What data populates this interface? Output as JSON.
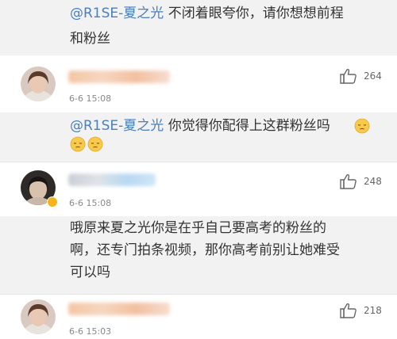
{
  "colors": {
    "mention": "#4a7fbf",
    "timestamp": "#888888",
    "background": "#f2f2f2"
  },
  "top_reply": {
    "mention": "@R1SE-夏之光",
    "text_line1": " 不闭着眼夸你，请你想想前程",
    "text_line2": "和粉丝"
  },
  "comments": [
    {
      "time": "6-6 15:08",
      "likes": "264",
      "reply_mention": "@R1SE-夏之光",
      "reply_text": " 你觉得你配得上这群粉丝吗",
      "emoji_icons": [
        "pensive-face-icon",
        "pensive-face-icon",
        "pensive-face-icon"
      ]
    },
    {
      "time": "6-6 15:08",
      "likes": "248",
      "reply_line1": "哦原来夏之光你是在乎自己要高考的粉丝的",
      "reply_line2": "啊，还专门拍条视频，那你高考前别让她难受",
      "reply_line3": "可以吗"
    },
    {
      "time": "6-6 15:03",
      "likes": "218"
    }
  ]
}
